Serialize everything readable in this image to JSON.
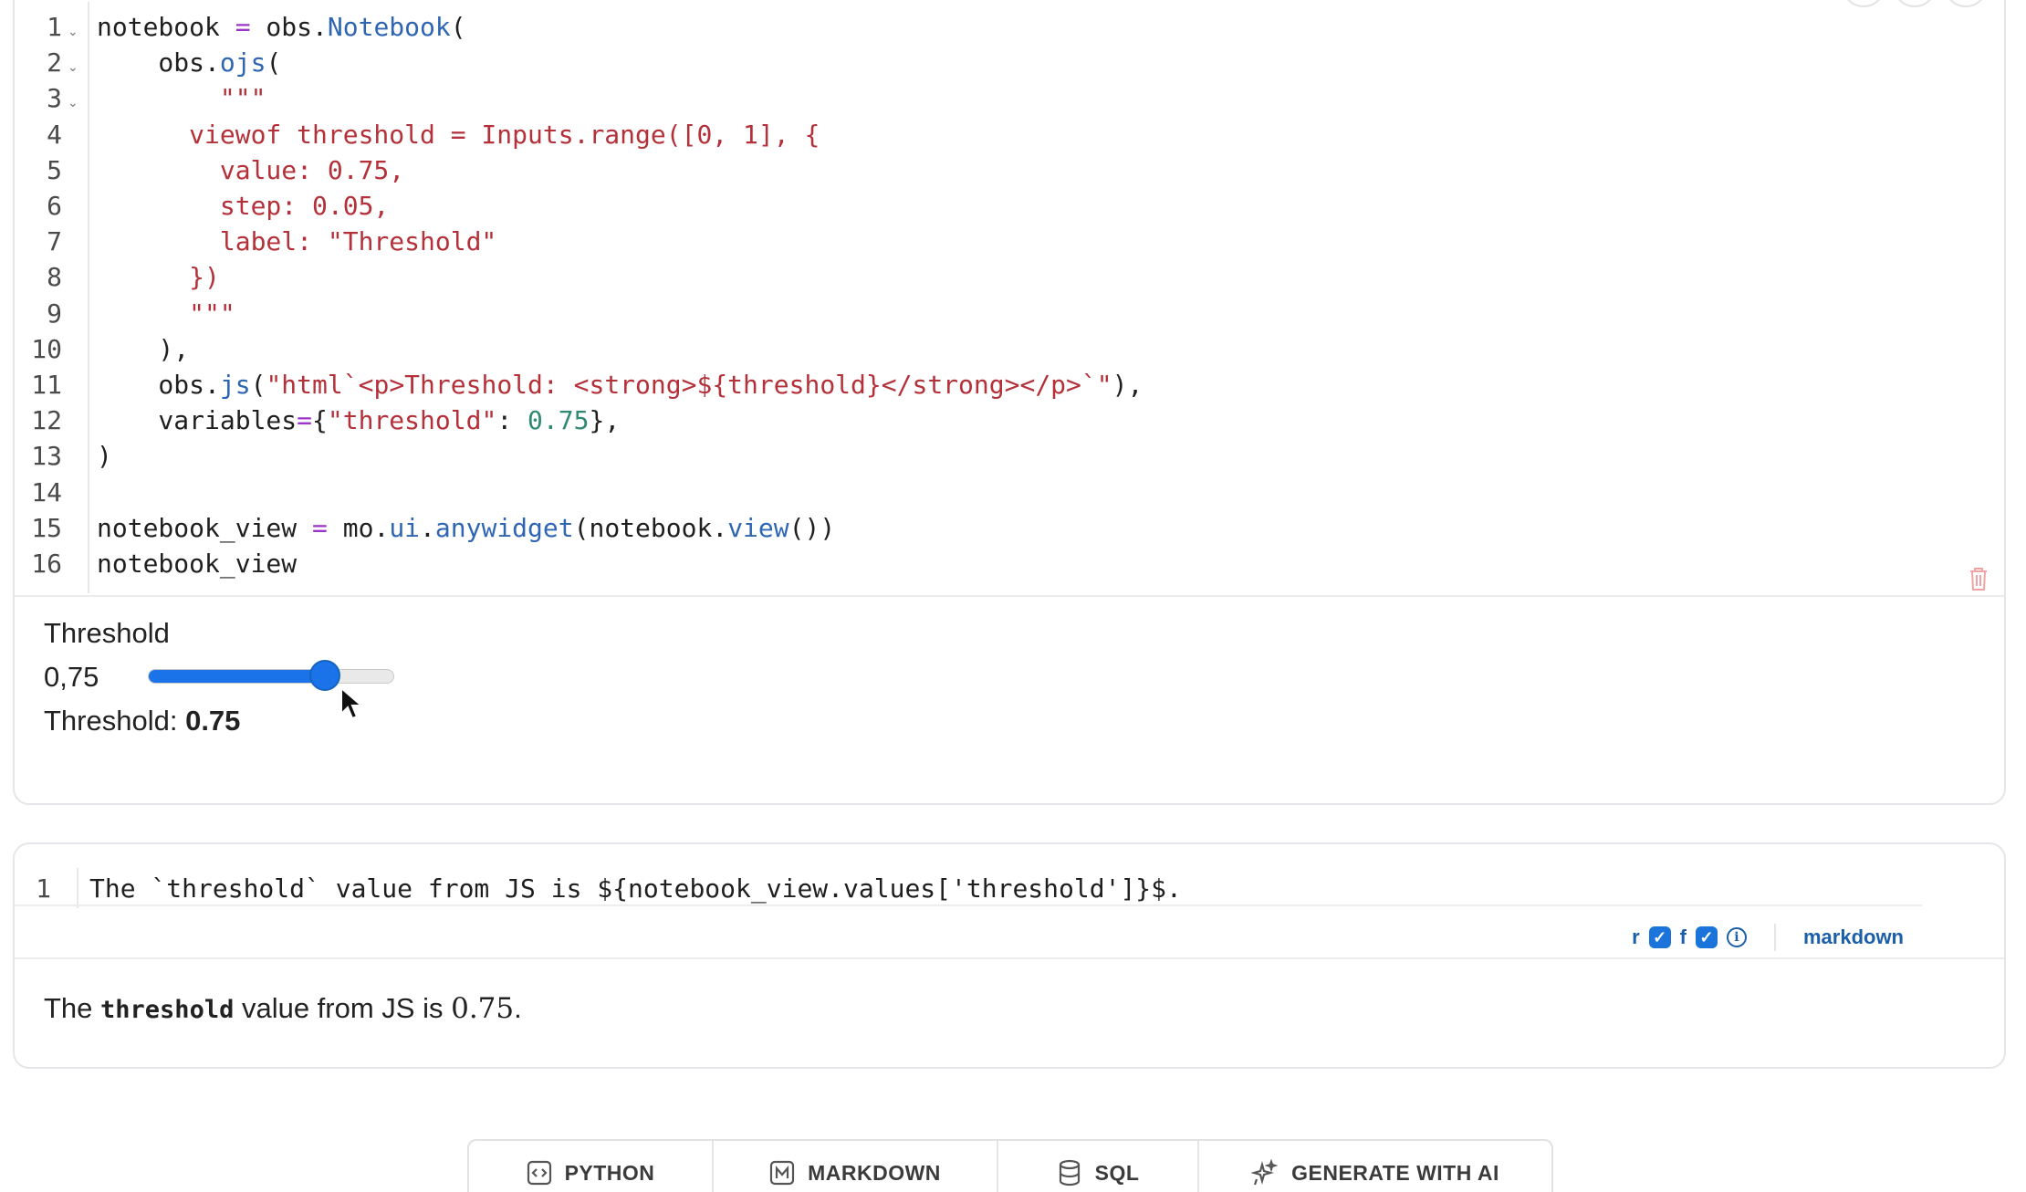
{
  "code_cell": {
    "lines": [
      {
        "num": "1",
        "fold": true,
        "tokens": [
          [
            "notebook ",
            "var"
          ],
          [
            "=",
            "op"
          ],
          [
            " obs",
            "var"
          ],
          [
            ".",
            "dot"
          ],
          [
            "Notebook",
            "fn"
          ],
          [
            "(",
            "var"
          ]
        ]
      },
      {
        "num": "2",
        "fold": true,
        "tokens": [
          [
            "    obs",
            "var"
          ],
          [
            ".",
            "dot"
          ],
          [
            "ojs",
            "fn"
          ],
          [
            "(",
            "var"
          ]
        ]
      },
      {
        "num": "3",
        "fold": true,
        "tokens": [
          [
            "        \"\"\"",
            "str"
          ]
        ]
      },
      {
        "num": "4",
        "fold": false,
        "tokens": [
          [
            "      viewof threshold = Inputs.range([0, 1], {",
            "str"
          ]
        ]
      },
      {
        "num": "5",
        "fold": false,
        "tokens": [
          [
            "        value: 0.75,",
            "str"
          ]
        ]
      },
      {
        "num": "6",
        "fold": false,
        "tokens": [
          [
            "        step: 0.05,",
            "str"
          ]
        ]
      },
      {
        "num": "7",
        "fold": false,
        "tokens": [
          [
            "        label: \"Threshold\"",
            "str"
          ]
        ]
      },
      {
        "num": "8",
        "fold": false,
        "tokens": [
          [
            "      })",
            "str"
          ]
        ]
      },
      {
        "num": "9",
        "fold": false,
        "tokens": [
          [
            "      \"\"\"",
            "str"
          ]
        ]
      },
      {
        "num": "10",
        "fold": false,
        "tokens": [
          [
            "    ),",
            "var"
          ]
        ]
      },
      {
        "num": "11",
        "fold": false,
        "tokens": [
          [
            "    obs",
            "var"
          ],
          [
            ".",
            "dot"
          ],
          [
            "js",
            "fn"
          ],
          [
            "(",
            "var"
          ],
          [
            "\"html`<p>Threshold: <strong>${threshold}</strong></p>`\"",
            "str"
          ],
          [
            "),",
            "var"
          ]
        ]
      },
      {
        "num": "12",
        "fold": false,
        "tokens": [
          [
            "    variables",
            "var"
          ],
          [
            "=",
            "op"
          ],
          [
            "{",
            "var"
          ],
          [
            "\"threshold\"",
            "str"
          ],
          [
            ": ",
            "var"
          ],
          [
            "0.75",
            "num"
          ],
          [
            "},",
            "var"
          ]
        ]
      },
      {
        "num": "13",
        "fold": false,
        "tokens": [
          [
            ")",
            "var"
          ]
        ]
      },
      {
        "num": "14",
        "fold": false,
        "tokens": []
      },
      {
        "num": "15",
        "fold": false,
        "tokens": [
          [
            "notebook_view ",
            "var"
          ],
          [
            "=",
            "op"
          ],
          [
            " mo",
            "var"
          ],
          [
            ".",
            "dot"
          ],
          [
            "ui",
            "fn"
          ],
          [
            ".",
            "dot"
          ],
          [
            "anywidget",
            "fn"
          ],
          [
            "(notebook",
            "var"
          ],
          [
            ".",
            "dot"
          ],
          [
            "view",
            "fn"
          ],
          [
            "())",
            "var"
          ]
        ]
      },
      {
        "num": "16",
        "fold": false,
        "tokens": [
          [
            "notebook_view",
            "var"
          ]
        ]
      }
    ]
  },
  "output": {
    "slider_label": "Threshold",
    "slider_value_text": "0,75",
    "slider_fraction": 0.75,
    "result_prefix": "Threshold: ",
    "result_value": "0.75"
  },
  "markdown_cell": {
    "line_number": "1",
    "source": "The `threshold` value from JS is ${notebook_view.values['threshold']}$.",
    "flag_r": "r",
    "flag_f": "f",
    "language": "markdown",
    "rendered_prefix": "The ",
    "rendered_code": "threshold",
    "rendered_middle": " value from JS is ",
    "rendered_value": "0.75",
    "rendered_suffix": "."
  },
  "add_bar": {
    "python": "PYTHON",
    "markdown": "MARKDOWN",
    "sql": "SQL",
    "ai": "GENERATE WITH AI"
  },
  "colors": {
    "accent": "#1a73e8",
    "keyword_fn": "#2f66b3",
    "string": "#b4313a",
    "operator": "#9b34c8",
    "number": "#2f8a74"
  }
}
